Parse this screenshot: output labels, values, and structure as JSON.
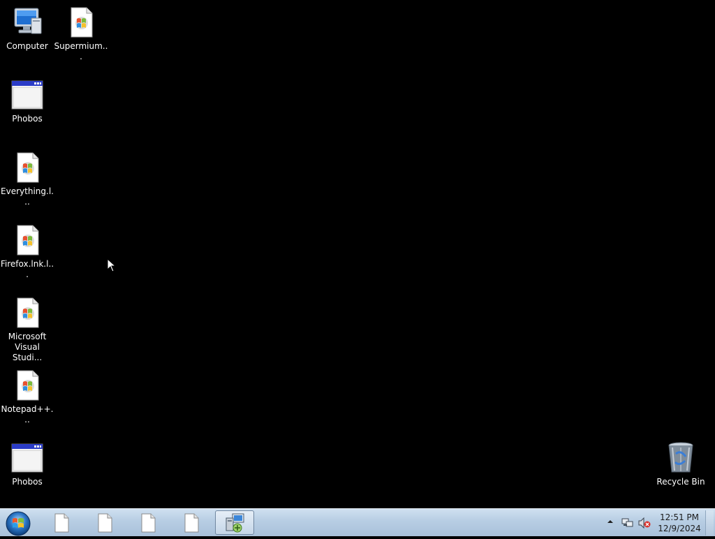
{
  "desktop": {
    "icons": [
      {
        "label": "Computer",
        "icon": "computer-icon"
      },
      {
        "label": "Supermium...",
        "icon": "generic-program-file-icon"
      },
      {
        "label": "Phobos",
        "icon": "application-window-icon"
      },
      {
        "label": "Everything.l...",
        "icon": "generic-program-file-icon"
      },
      {
        "label": "Firefox.lnk.l...",
        "icon": "generic-program-file-icon"
      },
      {
        "label": "Microsoft Visual Studi...",
        "icon": "generic-program-file-icon"
      },
      {
        "label": "Notepad++...",
        "icon": "generic-program-file-icon"
      },
      {
        "label": "Phobos",
        "icon": "application-window-icon"
      },
      {
        "label": "Recycle Bin",
        "icon": "recycle-bin-icon"
      }
    ],
    "background_color": "#000000"
  },
  "taskbar": {
    "start_icon": "windows-orb-icon",
    "buttons": [
      {
        "icon": "blank-document-icon",
        "active": false
      },
      {
        "icon": "blank-document-icon",
        "active": false
      },
      {
        "icon": "blank-document-icon",
        "active": false
      },
      {
        "icon": "blank-document-icon",
        "active": false
      },
      {
        "icon": "remote-desktop-connection-icon",
        "active": true
      }
    ],
    "tray": {
      "chevron_icon": "show-hidden-icons-chevron",
      "network_icon": "network-icon",
      "volume_icon": "volume-muted-icon"
    },
    "clock": {
      "time": "12:51 PM",
      "date": "12/9/2024"
    }
  }
}
